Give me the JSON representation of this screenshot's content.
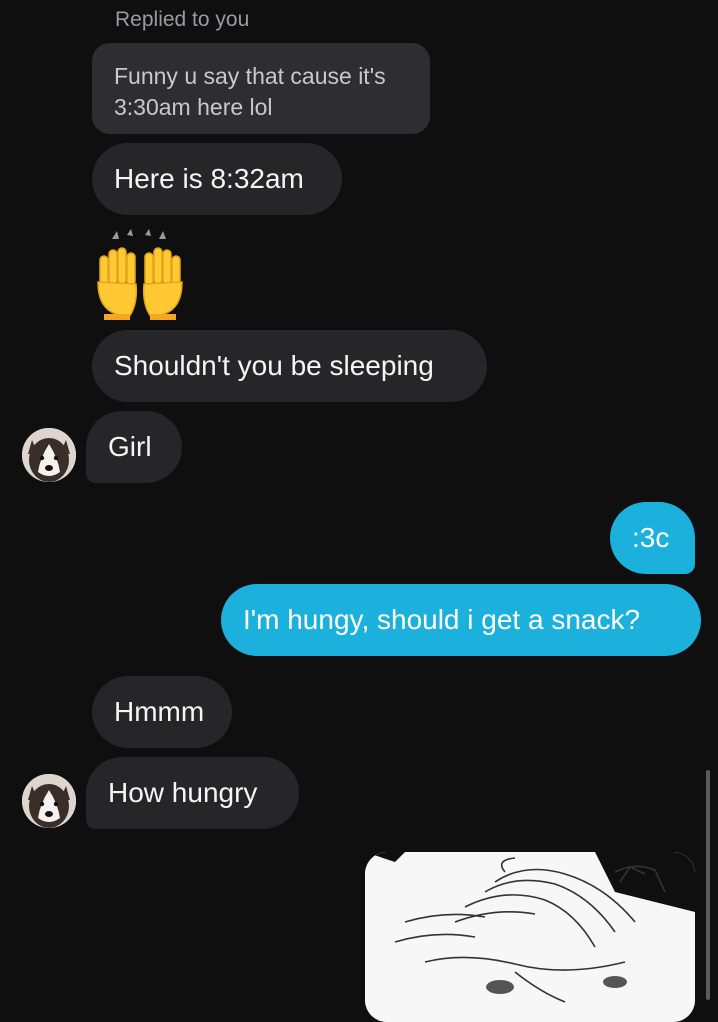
{
  "conversation": {
    "replied_label": "Replied to you",
    "quoted_message": "Funny u say that cause it's 3:30am here lol",
    "messages": [
      {
        "text": "Here is 8:32am",
        "direction": "incoming"
      },
      {
        "emoji": "raising-hands",
        "direction": "incoming"
      },
      {
        "text": "Shouldn't you be sleeping",
        "direction": "incoming"
      },
      {
        "text": "Girl",
        "direction": "incoming"
      },
      {
        "text": ":3c",
        "direction": "outgoing"
      },
      {
        "text": "I'm hungy, should i get a snack?",
        "direction": "outgoing"
      },
      {
        "text": "Hmmm",
        "direction": "incoming"
      },
      {
        "text": "How hungry",
        "direction": "incoming"
      },
      {
        "image": "horse-sketch",
        "direction": "outgoing"
      }
    ]
  },
  "colors": {
    "background": "#0f0f10",
    "incoming_bubble": "#262628",
    "outgoing_bubble": "#1bb1dc",
    "quote_bubble": "#2e2e31"
  }
}
